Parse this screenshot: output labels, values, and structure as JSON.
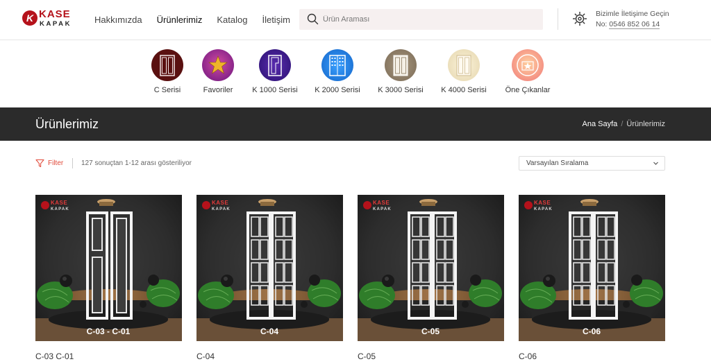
{
  "brand": {
    "logo_text_top": "KASE",
    "logo_text_bottom": "KAPAK",
    "logo_mark": "K"
  },
  "nav": [
    {
      "label": "Hakkımızda"
    },
    {
      "label": "Ürünlerimiz"
    },
    {
      "label": "Katalog"
    },
    {
      "label": "İletişim"
    }
  ],
  "search": {
    "placeholder": "Ürün Araması",
    "icon": "search-icon"
  },
  "contact": {
    "line1": "Bizimle İletişime Geçin",
    "prefix": "No: ",
    "phone": "0546 852 06 14",
    "icon": "gear-icon"
  },
  "categories": [
    {
      "label": "C Serisi",
      "color": "#5a1010"
    },
    {
      "label": "Favoriler",
      "color": "#7a1a8e"
    },
    {
      "label": "K 1000 Serisi",
      "color": "#3a1a8a"
    },
    {
      "label": "K 2000 Serisi",
      "color": "#1e7fe0"
    },
    {
      "label": "K 3000 Serisi",
      "color": "#8b7b66"
    },
    {
      "label": "K 4000 Serisi",
      "color": "#e8dcb8"
    },
    {
      "label": "Öne Çıkanlar",
      "color": "#f08a8a"
    }
  ],
  "page": {
    "title": "Ürünlerimiz"
  },
  "breadcrumb": {
    "home": "Ana Sayfa",
    "separator": "/",
    "current": "Ürünlerimiz"
  },
  "toolbar": {
    "filter": "Filter",
    "results": "127 sonuçtan 1-12 arası gösteriliyor",
    "sort": "Varsayılan Sıralama"
  },
  "products": [
    {
      "name": "C-03 C-01",
      "plate": "C-03 - C-01",
      "style": "plain"
    },
    {
      "name": "C-04",
      "plate": "C-04",
      "style": "grid"
    },
    {
      "name": "C-05",
      "plate": "C-05",
      "style": "arch"
    },
    {
      "name": "C-06",
      "plate": "C-06",
      "style": "narrow"
    }
  ],
  "colors": {
    "accent": "#e14b3b",
    "brand": "#b5121b",
    "titlebar": "#2b2b2b"
  }
}
